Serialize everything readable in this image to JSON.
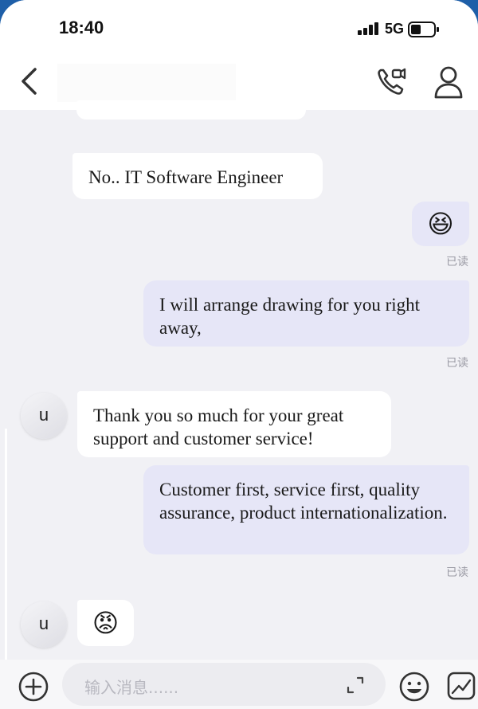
{
  "status_bar": {
    "time": "18:40",
    "network": "5G",
    "battery_icon": "battery-icon",
    "signal_icon": "signal-icon"
  },
  "nav": {
    "title": "",
    "back_icon": "chevron-left-icon",
    "call_icon": "phone-video-icon",
    "profile_icon": "person-icon"
  },
  "messages": [
    {
      "side": "in",
      "type": "text",
      "text": "No.. IT Software Engineer"
    },
    {
      "side": "out",
      "type": "emoji",
      "emoji": "😆",
      "status": "已读"
    },
    {
      "side": "out",
      "type": "text",
      "text": "I will arrange drawing for you right away,",
      "status": "已读"
    },
    {
      "side": "in",
      "type": "text",
      "avatar": "u",
      "text": "Thank you so much for your great support and customer service!"
    },
    {
      "side": "out",
      "type": "text",
      "text": "Customer first, service first, quality assurance, product internationalization.",
      "status": "已读"
    },
    {
      "side": "in",
      "type": "emoji",
      "avatar": "u",
      "emoji": "😡"
    }
  ],
  "input": {
    "placeholder": "输入消息......"
  },
  "colors": {
    "outgoing_bubble": "#e6e6f7",
    "incoming_bubble": "#ffffff",
    "chat_bg": "#f1f1f5"
  }
}
